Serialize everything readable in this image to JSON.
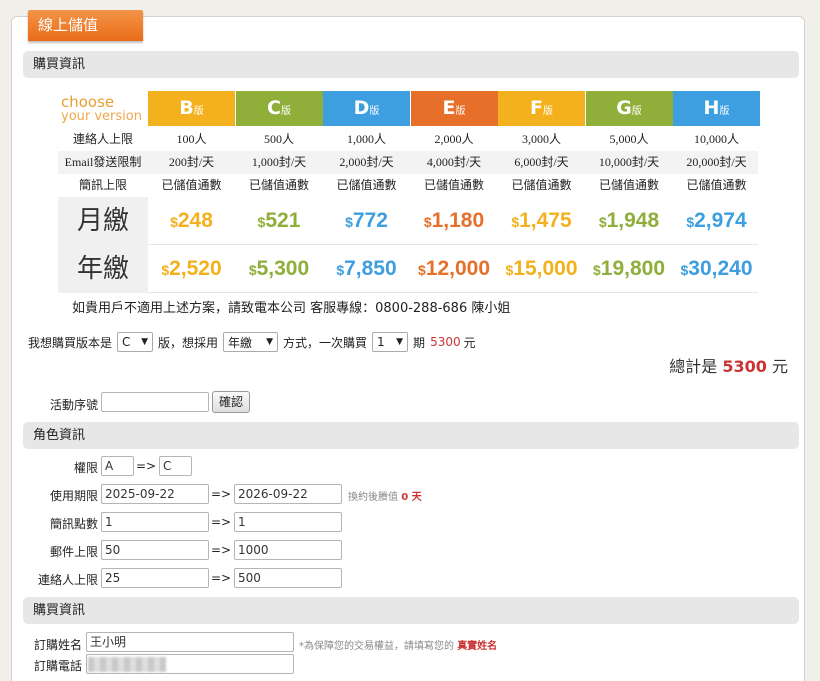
{
  "tab_title": "線上儲值",
  "sections": {
    "purchase_info": "購買資訊",
    "role_info": "角色資訊",
    "buyer_info": "購買資訊"
  },
  "choose": {
    "line1": "choose",
    "line2": "your version"
  },
  "versions": [
    {
      "letter": "B",
      "suffix": "版",
      "color": "#f4b11e",
      "contacts": "100人",
      "email": "200封/天",
      "sms": "已儲值通數",
      "monthly": "248",
      "yearly": "2,520"
    },
    {
      "letter": "C",
      "suffix": "版",
      "color": "#8fae3a",
      "contacts": "500人",
      "email": "1,000封/天",
      "sms": "已儲值通數",
      "monthly": "521",
      "yearly": "5,300"
    },
    {
      "letter": "D",
      "suffix": "版",
      "color": "#3d9ee0",
      "contacts": "1,000人",
      "email": "2,000封/天",
      "sms": "已儲值通數",
      "monthly": "772",
      "yearly": "7,850"
    },
    {
      "letter": "E",
      "suffix": "版",
      "color": "#e6702a",
      "contacts": "2,000人",
      "email": "4,000封/天",
      "sms": "已儲值通數",
      "monthly": "1,180",
      "yearly": "12,000"
    },
    {
      "letter": "F",
      "suffix": "版",
      "color": "#f4b11e",
      "contacts": "3,000人",
      "email": "6,000封/天",
      "sms": "已儲值通數",
      "monthly": "1,475",
      "yearly": "15,000"
    },
    {
      "letter": "G",
      "suffix": "版",
      "color": "#8fae3a",
      "contacts": "5,000人",
      "email": "10,000封/天",
      "sms": "已儲值通數",
      "monthly": "1,948",
      "yearly": "19,800"
    },
    {
      "letter": "H",
      "suffix": "版",
      "color": "#3d9ee0",
      "contacts": "10,000人",
      "email": "20,000封/天",
      "sms": "已儲值通數",
      "monthly": "2,974",
      "yearly": "30,240"
    }
  ],
  "row_labels": {
    "contacts": "連絡人上限",
    "email": "Email發送限制",
    "sms": "簡訊上限",
    "monthly": "月繳",
    "yearly": "年繳"
  },
  "currency_symbol": "$",
  "note": "如貴用戶不適用上述方案，請致電本公司 客服專線：0800-288-686 陳小姐",
  "purchase_form": {
    "text1": "我想購買版本是",
    "version_value": "C",
    "text2": "版，想採用",
    "method_value": "年繳",
    "text3": "方式，一次購買",
    "period_value": "1",
    "text4": "期",
    "price": "5300",
    "unit": "元"
  },
  "total": {
    "label": "總計是",
    "amount": "5300",
    "unit": "元"
  },
  "promo": {
    "label": "活動序號",
    "value": "",
    "confirm_label": "確認"
  },
  "role_fields": {
    "permission": {
      "label": "權限",
      "from": "A",
      "arrow": "=>",
      "to": "C"
    },
    "period": {
      "label": "使用期限",
      "from": "2025-09-22",
      "arrow": "=>",
      "to": "2026-09-22",
      "hint": "換約後賸值",
      "hint_value": "0 天"
    },
    "sms_points": {
      "label": "簡訊點數",
      "from": "1",
      "arrow": "=>",
      "to": "1"
    },
    "mail_limit": {
      "label": "郵件上限",
      "from": "50",
      "arrow": "=>",
      "to": "1000"
    },
    "contact_limit": {
      "label": "連絡人上限",
      "from": "25",
      "arrow": "=>",
      "to": "500"
    }
  },
  "buyer": {
    "name_label": "訂購姓名",
    "name_value": "王小明",
    "name_hint": "*為保障您的交易權益，請填寫您的",
    "name_hint_strong": "真實姓名",
    "phone_label": "訂購電話"
  }
}
